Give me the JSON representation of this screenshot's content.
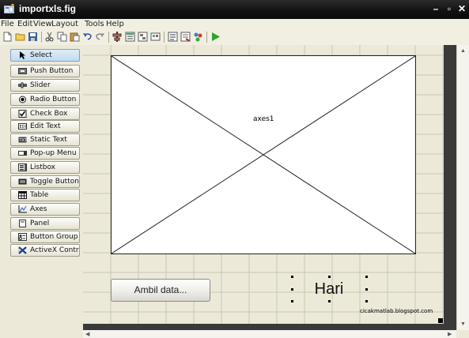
{
  "window": {
    "title": "importxls.fig"
  },
  "menu": [
    "File",
    "Edit",
    "View",
    "Layout",
    "Tools",
    "Help"
  ],
  "toolbar": [
    "new-file",
    "open-folder",
    "save",
    "cut",
    "copy",
    "paste",
    "undo",
    "redo",
    "align",
    "menu-editor",
    "tab-order-editor",
    "toolbar-editor",
    "mfile-editor",
    "property-inspector",
    "object-browser",
    "run"
  ],
  "palette": [
    {
      "label": "Select",
      "icon": "arrow-cursor-icon"
    },
    {
      "label": "Push Button",
      "icon": "ok-button-icon"
    },
    {
      "label": "Slider",
      "icon": "slider-icon"
    },
    {
      "label": "Radio Button",
      "icon": "radio-icon"
    },
    {
      "label": "Check Box",
      "icon": "checkbox-icon"
    },
    {
      "label": "Edit Text",
      "icon": "edit-text-icon"
    },
    {
      "label": "Static Text",
      "icon": "static-text-icon"
    },
    {
      "label": "Pop-up Menu",
      "icon": "popup-icon"
    },
    {
      "label": "Listbox",
      "icon": "listbox-icon"
    },
    {
      "label": "Toggle Button",
      "icon": "toggle-icon"
    },
    {
      "label": "Table",
      "icon": "table-icon"
    },
    {
      "label": "Axes",
      "icon": "axes-icon"
    },
    {
      "label": "Panel",
      "icon": "panel-icon"
    },
    {
      "label": "Button Group",
      "icon": "button-group-icon"
    },
    {
      "label": "ActiveX Control",
      "icon": "activex-icon"
    }
  ],
  "canvas": {
    "axes_label": "axes1",
    "push_button": "Ambil data...",
    "static_text": "Hari",
    "credit": "cicakmatlab.blogspot.com"
  }
}
